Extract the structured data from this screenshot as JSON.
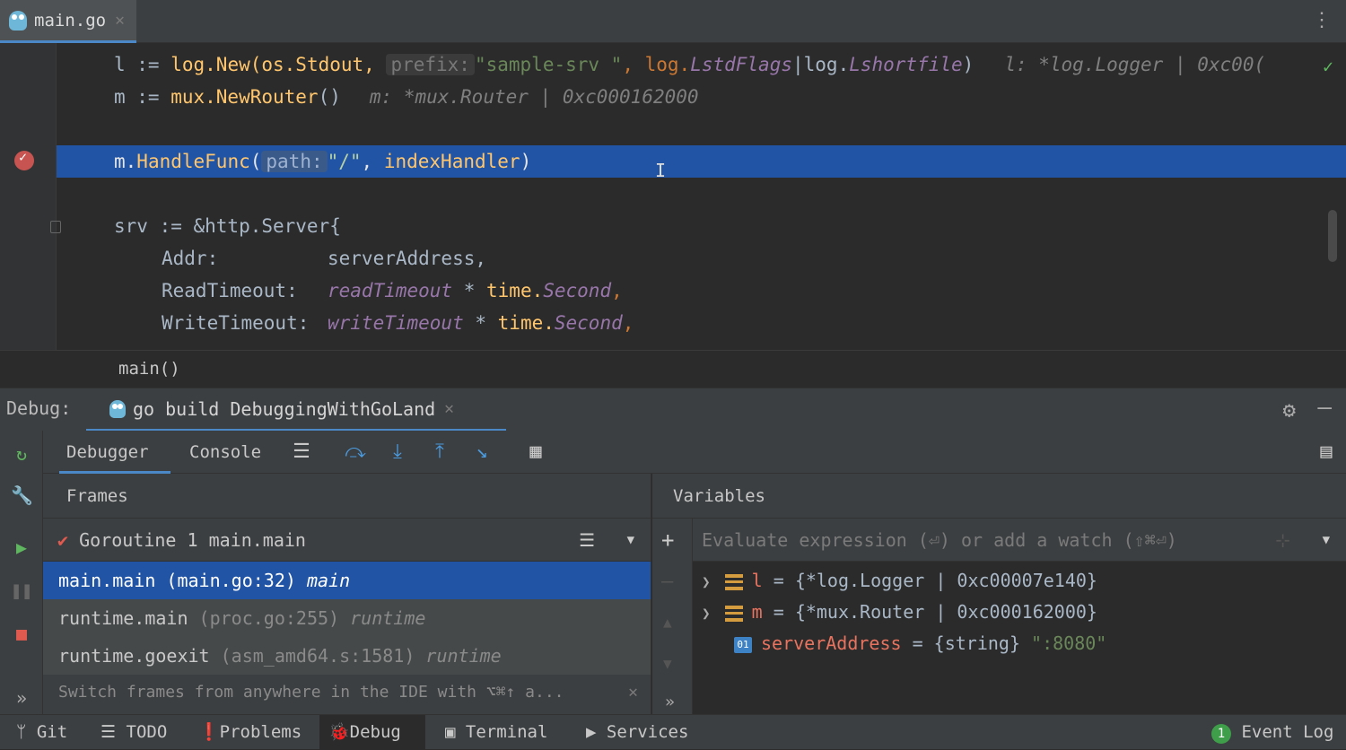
{
  "tabs": [
    {
      "label": "main.go"
    }
  ],
  "editor": {
    "line1": {
      "pre": "l := ",
      "fn1": "log",
      "fn2": ".New(os.Stdout, ",
      "hint": "prefix:",
      "str": "\"sample-srv \"",
      "rest1": ", log.",
      "c1": "LstdFlags",
      "bar": "|log.",
      "c2": "Lshortfile",
      "close": ")",
      "inlay": "l: *log.Logger | 0xc00("
    },
    "line2": {
      "pre": "m := ",
      "fn": "mux.NewRouter",
      "close": "()",
      "inlay": "m: *mux.Router | 0xc000162000"
    },
    "line3": {
      "pre": "m.",
      "fn": "HandleFunc",
      "open": "(",
      "hint": "path:",
      "str": "\"/\"",
      "mid": ", ",
      "arg": "indexHandler",
      "close": ")"
    },
    "line4": "srv := &http.Server{",
    "line5": {
      "key": "Addr:",
      "val": "serverAddress,"
    },
    "line6": {
      "key": "ReadTimeout:",
      "var": "readTimeout",
      "op": " * ",
      "pkg": "time.",
      "cst": "Second",
      "end": ","
    },
    "line7": {
      "key": "WriteTimeout:",
      "var": "writeTimeout",
      "op": " * ",
      "pkg": "time.",
      "cst": "Second",
      "end": ","
    }
  },
  "breadcrumb": "main()",
  "debug": {
    "label": "Debug:",
    "session": "go build DebuggingWithGoLand",
    "tabs": {
      "debugger": "Debugger",
      "console": "Console"
    }
  },
  "frames": {
    "title": "Frames",
    "goroutine": "Goroutine 1 main.main",
    "items": [
      {
        "fn": "main.main",
        "loc": "(main.go:32)",
        "meta": "main"
      },
      {
        "fn": "runtime.main",
        "loc": "(proc.go:255)",
        "meta": "runtime"
      },
      {
        "fn": "runtime.goexit",
        "loc": "(asm_amd64.s:1581)",
        "meta": "runtime"
      }
    ],
    "tip": "Switch frames from anywhere in the IDE with ⌥⌘↑ a..."
  },
  "variables": {
    "title": "Variables",
    "eval_placeholder": "Evaluate expression (⏎) or add a watch (⇧⌘⏎)",
    "items": [
      {
        "name": "l",
        "eq": " = ",
        "value": "{*log.Logger | 0xc00007e140}"
      },
      {
        "name": "m",
        "eq": " = ",
        "value": "{*mux.Router | 0xc000162000}"
      },
      {
        "name": "serverAddress",
        "eq": " = ",
        "type": "{string} ",
        "value": "\":8080\""
      }
    ]
  },
  "statusbar": {
    "git": "Git",
    "todo": "TODO",
    "problems": "Problems",
    "debug": "Debug",
    "terminal": "Terminal",
    "services": "Services",
    "event_count": "1",
    "event_log": "Event Log"
  },
  "colors": {
    "accent": "#4a88c7",
    "selection": "#2154a5",
    "breakpoint": "#c75450",
    "string": "#6a8759",
    "function": "#ffc66d",
    "constant": "#9876aa"
  }
}
